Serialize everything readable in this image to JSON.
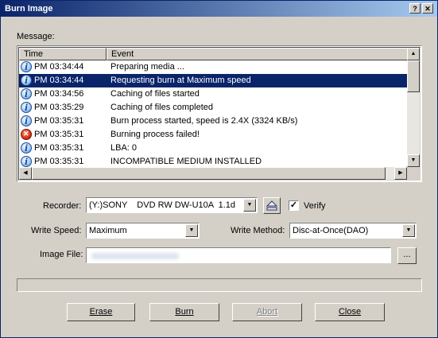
{
  "window": {
    "title": "Burn Image",
    "help_label": "?",
    "close_label": "✕"
  },
  "message_label": "Message:",
  "log": {
    "columns": [
      "Time",
      "Event"
    ],
    "rows": [
      {
        "icon": "info-icon",
        "time": "PM 03:34:44",
        "event": "Preparing media ..."
      },
      {
        "icon": "info-icon",
        "time": "PM 03:34:44",
        "event": "Requesting burn at Maximum speed",
        "selected": true
      },
      {
        "icon": "info-icon",
        "time": "PM 03:34:56",
        "event": "Caching of files started"
      },
      {
        "icon": "info-icon",
        "time": "PM 03:35:29",
        "event": "Caching of files completed"
      },
      {
        "icon": "info-icon",
        "time": "PM 03:35:31",
        "event": "Burn process started, speed is 2.4X (3324 KB/s)"
      },
      {
        "icon": "error-icon",
        "time": "PM 03:35:31",
        "event": "Burning process failed!"
      },
      {
        "icon": "info-icon",
        "time": "PM 03:35:31",
        "event": "LBA: 0"
      },
      {
        "icon": "info-icon",
        "time": "PM 03:35:31",
        "event": "INCOMPATIBLE MEDIUM INSTALLED"
      }
    ]
  },
  "recorder": {
    "label": "Recorder:",
    "value": "(Y:)SONY    DVD RW DW-U10A  1.1d"
  },
  "verify": {
    "label": "Verify",
    "checked": true
  },
  "write_speed": {
    "label": "Write Speed:",
    "value": "Maximum"
  },
  "write_method": {
    "label": "Write Method:",
    "value": "Disc-at-Once(DAO)"
  },
  "image_file": {
    "label": "Image File:",
    "browse_label": "..."
  },
  "progress": {
    "value": 0
  },
  "buttons": {
    "erase": "Erase",
    "burn": "Burn",
    "abort": "Abort",
    "close": "Close"
  }
}
